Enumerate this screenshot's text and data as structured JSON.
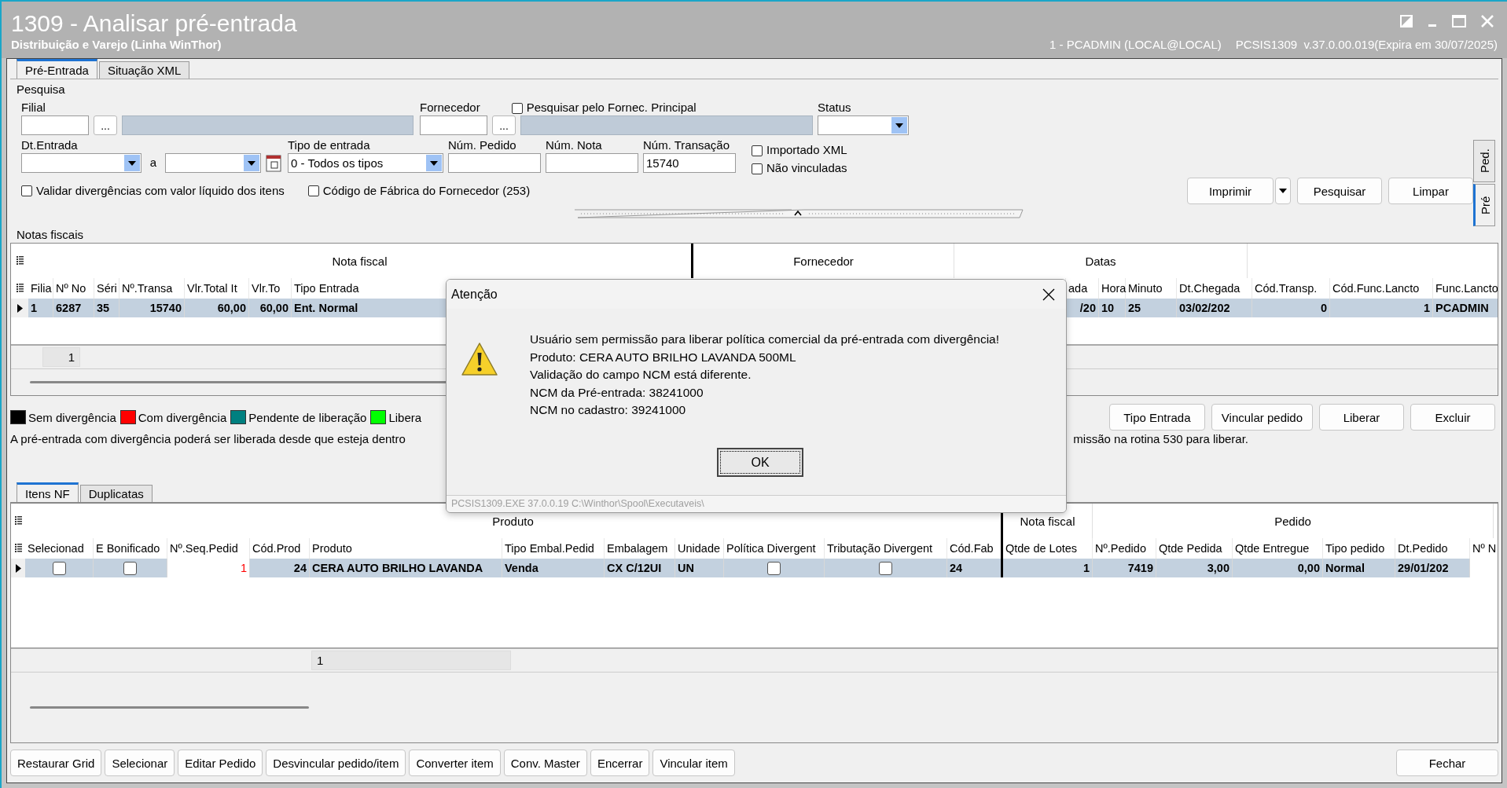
{
  "window": {
    "title": "1309 - Analisar pré-entrada",
    "subtitle": "Distribuição e Varejo (Linha WinThor)",
    "user": "1 - PCADMIN (LOCAL@LOCAL)",
    "version": "PCSIS1309  v.37.0.00.019(Expira em 30/07/2025)"
  },
  "tabs": [
    {
      "label": "Pré-Entrada",
      "selected": true
    },
    {
      "label": "Situação XML",
      "selected": false
    }
  ],
  "search": {
    "title": "Pesquisa",
    "filial": {
      "label": "Filial",
      "lookup": "..."
    },
    "fornecedor": {
      "label": "Fornecedor",
      "lookup": "..."
    },
    "principal": {
      "label": "Pesquisar pelo Fornec. Principal",
      "checked": false
    },
    "status": {
      "label": "Status"
    },
    "dt_entrada": {
      "label": "Dt.Entrada",
      "separator": "a"
    },
    "tipo_entrada": {
      "label": "Tipo de entrada",
      "value": "0 - Todos os tipos"
    },
    "num_pedido": {
      "label": "Núm. Pedido"
    },
    "num_nota": {
      "label": "Núm. Nota"
    },
    "num_transacao": {
      "label": "Núm. Transação",
      "value": "15740"
    },
    "options": [
      {
        "label": "Importado XML",
        "checked": false
      },
      {
        "label": "Não vinculadas",
        "checked": false
      }
    ],
    "filters": [
      {
        "label": "Validar divergências com valor líquido dos itens",
        "checked": false
      },
      {
        "label": "Código de Fábrica do Fornecedor (253)",
        "checked": false
      }
    ],
    "buttons": [
      "Imprimir",
      "Pesquisar",
      "Limpar"
    ]
  },
  "side_tabs": [
    {
      "label": "Ped.",
      "selected": false
    },
    {
      "label": "Pré",
      "selected": true
    }
  ],
  "notas": {
    "title": "Notas fiscais",
    "groups": [
      "Nota fiscal",
      "Fornecedor",
      "Datas"
    ],
    "columns": [
      "Filia",
      "Nº No",
      "Séri",
      "Nº.Transa",
      "Vlr.Total It",
      "Vlr.To",
      "Tipo Entrada",
      "ada",
      "Hora",
      "Minuto",
      "Dt.Chegada",
      "Cód.Transp.",
      "Cód.Func.Lancto",
      "Func.Lancto"
    ],
    "rows": [
      {
        "selected": true,
        "cells": [
          {
            "kind": "text",
            "text": "1"
          },
          {
            "kind": "text",
            "text": "6287"
          },
          {
            "kind": "text",
            "text": "35"
          },
          {
            "kind": "number",
            "text": "15740"
          },
          {
            "kind": "number",
            "text": "60,00"
          },
          {
            "kind": "number",
            "text": "60,00"
          },
          {
            "kind": "text",
            "text": "Ent. Normal"
          },
          {
            "kind": "number",
            "text": "/20"
          },
          {
            "kind": "text",
            "text": "10"
          },
          {
            "kind": "text",
            "text": "25"
          },
          {
            "kind": "text",
            "text": "03/02/202"
          },
          {
            "kind": "number",
            "text": "0"
          },
          {
            "kind": "number",
            "text": "1"
          },
          {
            "kind": "text",
            "text": "PCADMIN"
          }
        ]
      }
    ],
    "footer": "1"
  },
  "legend": [
    {
      "label": "Sem divergência",
      "color": "#000000"
    },
    {
      "label": "Com divergência",
      "color": "#ff0000"
    },
    {
      "label": "Pendente de liberação",
      "color": "#008080"
    },
    {
      "label": "Libera",
      "color": "#00ff00"
    }
  ],
  "info": [
    "A pré-entrada com divergência poderá ser liberada desde que esteja dentro",
    "missão na rotina 530 para liberar."
  ],
  "actions": [
    "Tipo Entrada",
    "Vincular pedido",
    "Liberar",
    "Excluir"
  ],
  "item_tabs": [
    {
      "label": "Itens NF",
      "selected": true
    },
    {
      "label": "Duplicatas",
      "selected": false
    }
  ],
  "items": {
    "groups": [
      "Produto",
      "Nota fiscal",
      "Pedido"
    ],
    "columns": [
      "Selecionad",
      "E Bonificado",
      "Nº.Seq.Pedid",
      "Cód.Prod",
      "Produto",
      "Tipo Embal.Pedid",
      "Embalagem",
      "Unidade",
      "Política Divergent",
      "Tributação Divergent",
      "Cód.Fab",
      "Qtde de Lotes",
      "Nº.Pedido",
      "Qtde Pedida",
      "Qtde Entregue",
      "Tipo pedido",
      "Dt.Pedido",
      "Nº N"
    ],
    "rows": [
      {
        "selected": true,
        "cells": [
          {
            "kind": "check",
            "checked": false
          },
          {
            "kind": "check",
            "checked": false
          },
          {
            "kind": "alert",
            "text": "1"
          },
          {
            "kind": "number",
            "text": "24"
          },
          {
            "kind": "text",
            "text": "CERA AUTO BRILHO LAVANDA"
          },
          {
            "kind": "text",
            "text": "Venda"
          },
          {
            "kind": "text",
            "text": "CX C/12UI"
          },
          {
            "kind": "text",
            "text": "UN"
          },
          {
            "kind": "check",
            "checked": false
          },
          {
            "kind": "check",
            "checked": false
          },
          {
            "kind": "text",
            "text": "24"
          },
          {
            "kind": "number",
            "text": "1"
          },
          {
            "kind": "number",
            "text": "7419"
          },
          {
            "kind": "number",
            "text": "3,00"
          },
          {
            "kind": "number",
            "text": "0,00"
          },
          {
            "kind": "text",
            "text": "Normal"
          },
          {
            "kind": "text",
            "text": "29/01/202"
          }
        ]
      }
    ],
    "footer": "1"
  },
  "bottom_buttons": [
    "Restaurar Grid",
    "Selecionar",
    "Editar Pedido",
    "Desvincular pedido/item",
    "Converter item",
    "Conv. Master",
    "Encerrar",
    "Vincular item"
  ],
  "close_button": "Fechar",
  "dialog": {
    "title": "Atenção",
    "message": [
      "Usuário sem permissão para liberar política comercial da pré-entrada com divergência!",
      "Produto: CERA AUTO BRILHO LAVANDA 500ML",
      "Validação do campo NCM está diferente.",
      "NCM da Pré-entrada: 38241000",
      "NCM no cadastro: 39241000"
    ],
    "button": "OK",
    "footer": "PCSIS1309.EXE 37.0.0.19 C:\\Winthor\\Spool\\Executaveis\\"
  }
}
